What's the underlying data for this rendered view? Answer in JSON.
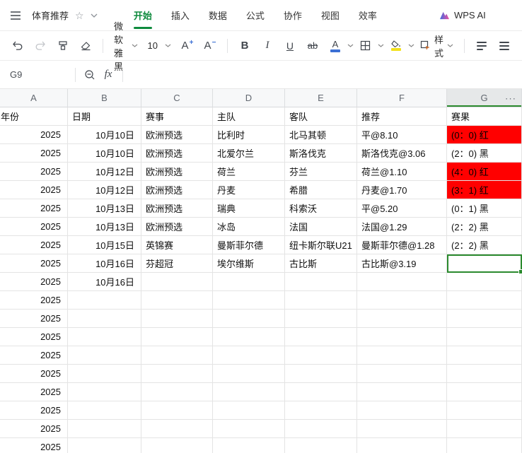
{
  "titlebar": {
    "title": "体育推荐",
    "tabs": [
      {
        "label": "开始",
        "active": true
      },
      {
        "label": "插入",
        "active": false
      },
      {
        "label": "数据",
        "active": false
      },
      {
        "label": "公式",
        "active": false
      },
      {
        "label": "协作",
        "active": false
      },
      {
        "label": "视图",
        "active": false
      },
      {
        "label": "效率",
        "active": false
      }
    ],
    "ai_label": "WPS AI"
  },
  "toolbar": {
    "font_name": "微软雅黑",
    "font_size": "10",
    "bold": "B",
    "italic": "I",
    "underline": "U",
    "strike": "ab",
    "style_label": "样式"
  },
  "formula_bar": {
    "cell_ref": "G9",
    "fx_label": "fx"
  },
  "sheet": {
    "columns": [
      "A",
      "B",
      "C",
      "D",
      "E",
      "F",
      "G"
    ],
    "selected_column": "G",
    "selected_cell": "G9",
    "more_label": "···",
    "rows": [
      {
        "cells": [
          "年份",
          "日期",
          "赛事",
          "主队",
          "客队",
          "推荐",
          "赛果"
        ],
        "header": true
      },
      {
        "cells": [
          "2025",
          "10月10日",
          "欧洲预选",
          "比利时",
          "北马其顿",
          "平@8.10",
          "(0：0) 红"
        ],
        "result": "red"
      },
      {
        "cells": [
          "2025",
          "10月10日",
          "欧洲预选",
          "北爱尔兰",
          "斯洛伐克",
          "斯洛伐克@3.06",
          "(2：0) 黑"
        ],
        "result": "black"
      },
      {
        "cells": [
          "2025",
          "10月12日",
          "欧洲预选",
          "荷兰",
          "芬兰",
          "荷兰@1.10",
          "(4：0) 红"
        ],
        "result": "red"
      },
      {
        "cells": [
          "2025",
          "10月12日",
          "欧洲预选",
          "丹麦",
          "希腊",
          "丹麦@1.70",
          "(3：1) 红"
        ],
        "result": "red"
      },
      {
        "cells": [
          "2025",
          "10月13日",
          "欧洲预选",
          "瑞典",
          "科索沃",
          "平@5.20",
          "(0：1) 黑"
        ],
        "result": "black"
      },
      {
        "cells": [
          "2025",
          "10月13日",
          "欧洲预选",
          "冰岛",
          "法国",
          "法国@1.29",
          "(2：2) 黑"
        ],
        "result": "black"
      },
      {
        "cells": [
          "2025",
          "10月15日",
          "英锦赛",
          "曼斯菲尔德",
          "纽卡斯尔联U21",
          "曼斯菲尔德@1.28",
          "(2：2) 黑"
        ],
        "result": "black"
      },
      {
        "cells": [
          "2025",
          "10月16日",
          "芬超冠",
          "埃尔维斯",
          "古比斯",
          "古比斯@3.19",
          ""
        ],
        "result": "selected"
      },
      {
        "cells": [
          "2025",
          "10月16日",
          "",
          "",
          "",
          "",
          ""
        ]
      },
      {
        "cells": [
          "2025",
          "",
          "",
          "",
          "",
          "",
          ""
        ]
      },
      {
        "cells": [
          "2025",
          "",
          "",
          "",
          "",
          "",
          ""
        ]
      },
      {
        "cells": [
          "2025",
          "",
          "",
          "",
          "",
          "",
          ""
        ]
      },
      {
        "cells": [
          "2025",
          "",
          "",
          "",
          "",
          "",
          ""
        ]
      },
      {
        "cells": [
          "2025",
          "",
          "",
          "",
          "",
          "",
          ""
        ]
      },
      {
        "cells": [
          "2025",
          "",
          "",
          "",
          "",
          "",
          ""
        ]
      },
      {
        "cells": [
          "2025",
          "",
          "",
          "",
          "",
          "",
          ""
        ]
      },
      {
        "cells": [
          "2025",
          "",
          "",
          "",
          "",
          "",
          ""
        ]
      },
      {
        "cells": [
          "2025",
          "",
          "",
          "",
          "",
          "",
          ""
        ]
      }
    ]
  },
  "colors": {
    "accent_green": "#0e8a3d",
    "selection_green": "#2b8a2e",
    "result_red": "#ff0000",
    "fill_yellow": "#f3e11c",
    "font_blue": "#3b6fd4"
  }
}
